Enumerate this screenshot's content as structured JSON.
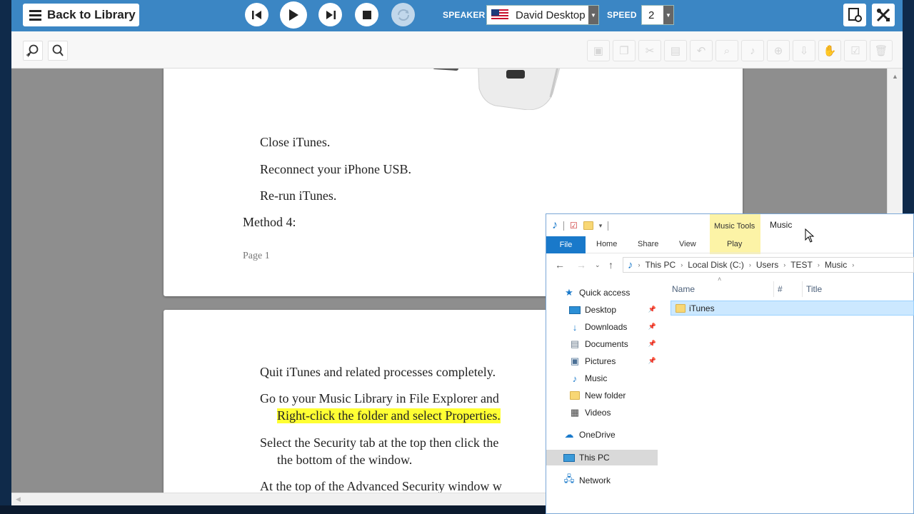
{
  "toolbar": {
    "back_label": "Back to Library",
    "speaker_label": "SPEAKER",
    "speaker_value": "David Desktop",
    "speed_label": "SPEED",
    "speed_value": "2"
  },
  "document": {
    "page1": {
      "lines": [
        "Close iTunes.",
        "Reconnect your iPhone USB.",
        "Re-run iTunes."
      ],
      "heading": "Method 4:",
      "page_number": "Page 1"
    },
    "page2": {
      "line1": "Quit iTunes and related processes completely.",
      "line2a": "Go to your Music Library in File Explorer and",
      "line2b_highlight": "Right-click the folder and select Properties.",
      "line3a": "Select the Security tab at the top then click the",
      "line3b": "the bottom of the window.",
      "line4": "At the top of the Advanced Security window w"
    }
  },
  "explorer": {
    "window_title": "Music",
    "context_tab": "Music Tools",
    "context_subtab": "Play",
    "ribbon_tabs": [
      "File",
      "Home",
      "Share",
      "View"
    ],
    "breadcrumb": [
      "This PC",
      "Local Disk (C:)",
      "Users",
      "TEST",
      "Music"
    ],
    "nav": {
      "quick_access": "Quick access",
      "desktop": "Desktop",
      "downloads": "Downloads",
      "documents": "Documents",
      "pictures": "Pictures",
      "music": "Music",
      "new_folder": "New folder",
      "videos": "Videos",
      "onedrive": "OneDrive",
      "this_pc": "This PC",
      "network": "Network"
    },
    "columns": {
      "name": "Name",
      "number": "#",
      "title": "Title"
    },
    "files": [
      "iTunes"
    ]
  },
  "colors": {
    "toolbar_blue": "#3b86c4",
    "highlight": "#ffff33",
    "file_tab": "#1979ca",
    "selection": "#cce8ff"
  }
}
